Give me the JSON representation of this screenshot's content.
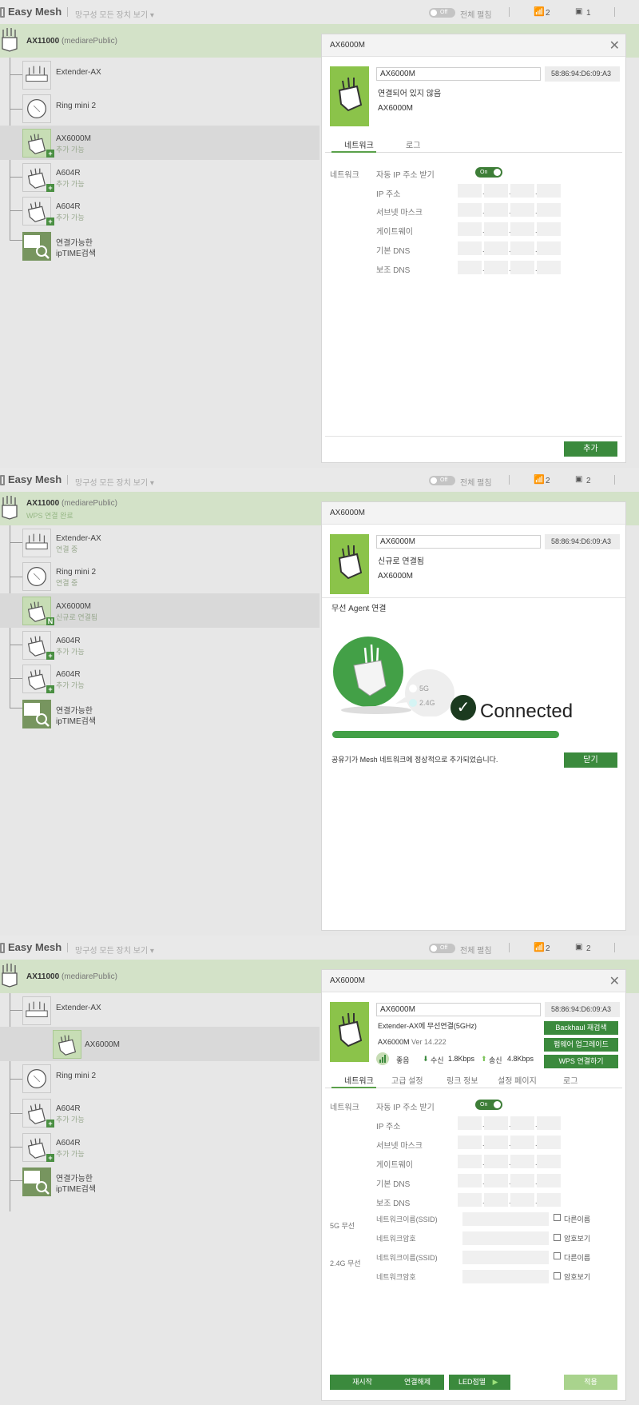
{
  "topbar": {
    "app_title": "Easy Mesh",
    "view_all": "망구성 모든 장치 보기 ▾",
    "toggle_label": "Off",
    "all_edit": "전체 펼침",
    "wifi_count": "2",
    "lan_count_1": "1",
    "lan_count_2": "2"
  },
  "root": {
    "name": "AX11000",
    "ssid": "(mediarePublic)",
    "status_done": "WPS 연결 완료"
  },
  "devices": {
    "extender": "Extender-AX",
    "ring": "Ring mini 2",
    "ax6000m": "AX6000M",
    "a604r": "A604R",
    "search_l1": "연결가능한",
    "search_l2": "ipTIME검색",
    "status_addable": "추가 가능",
    "status_connecting": "연결 중",
    "status_new": "신규로 연결됨"
  },
  "dialog1": {
    "title": "AX6000M",
    "name_value": "AX6000M",
    "mac": "58:86:94:D6:09:A3",
    "status": "연결되어 있지 않음",
    "model": "AX6000M",
    "tabs": [
      "네트워크",
      "로그"
    ],
    "section_network": "네트워크",
    "auto_ip": "자동 IP 주소 받기",
    "switch_on": "On",
    "fields": [
      "IP 주소",
      "서브넷 마스크",
      "게이트웨이",
      "기본 DNS",
      "보조 DNS"
    ],
    "add_button": "추가"
  },
  "dialog2": {
    "title": "AX6000M",
    "name_value": "AX6000M",
    "mac": "58:86:94:D6:09:A3",
    "status": "신규로 연결됨",
    "model": "AX6000M",
    "section": "무선 Agent 연결",
    "band_5g": "5G",
    "band_24g": "2.4G",
    "connected": "Connected",
    "message": "공유기가 Mesh 네트워크에 정상적으로 추가되었습니다.",
    "close_button": "닫기",
    "progress": 1.0
  },
  "dialog3": {
    "title": "AX6000M",
    "name_value": "AX6000M",
    "mac": "58:86:94:D6:09:A3",
    "connection": "Extender-AX에 무선연결(5GHz)",
    "model": "AX6000M",
    "version": "Ver 14.222",
    "signal": "좋음",
    "rx_label": "수신",
    "rx_value": "1.8Kbps",
    "tx_label": "송신",
    "tx_value": "4.8Kbps",
    "btn_backhaul": "Backhaul 재검색",
    "btn_firmware": "펌웨어 업그레이드",
    "btn_wps": "WPS 연결하기",
    "tabs": [
      "네트워크",
      "고급 설정",
      "링크 정보",
      "설정 페이지",
      "로그"
    ],
    "section_network": "네트워크",
    "auto_ip": "자동 IP 주소 받기",
    "switch_on": "On",
    "fields": [
      "IP 주소",
      "서브넷 마스크",
      "게이트웨이",
      "기본 DNS",
      "보조 DNS"
    ],
    "section_5g": "5G 무선",
    "section_24g": "2.4G 무선",
    "ssid_label": "네트워크이름(SSID)",
    "pw_label": "네트워크암호",
    "other_name": "다른이름",
    "show_pw": "암호보기",
    "btn_restart": "재시작",
    "btn_disconnect": "연결해제",
    "btn_led": "LED점멸",
    "btn_apply": "적용"
  },
  "colors": {
    "accent": "#3b8a3d",
    "device_green": "#8bc34a",
    "root_bg": "#d3e2c8"
  }
}
